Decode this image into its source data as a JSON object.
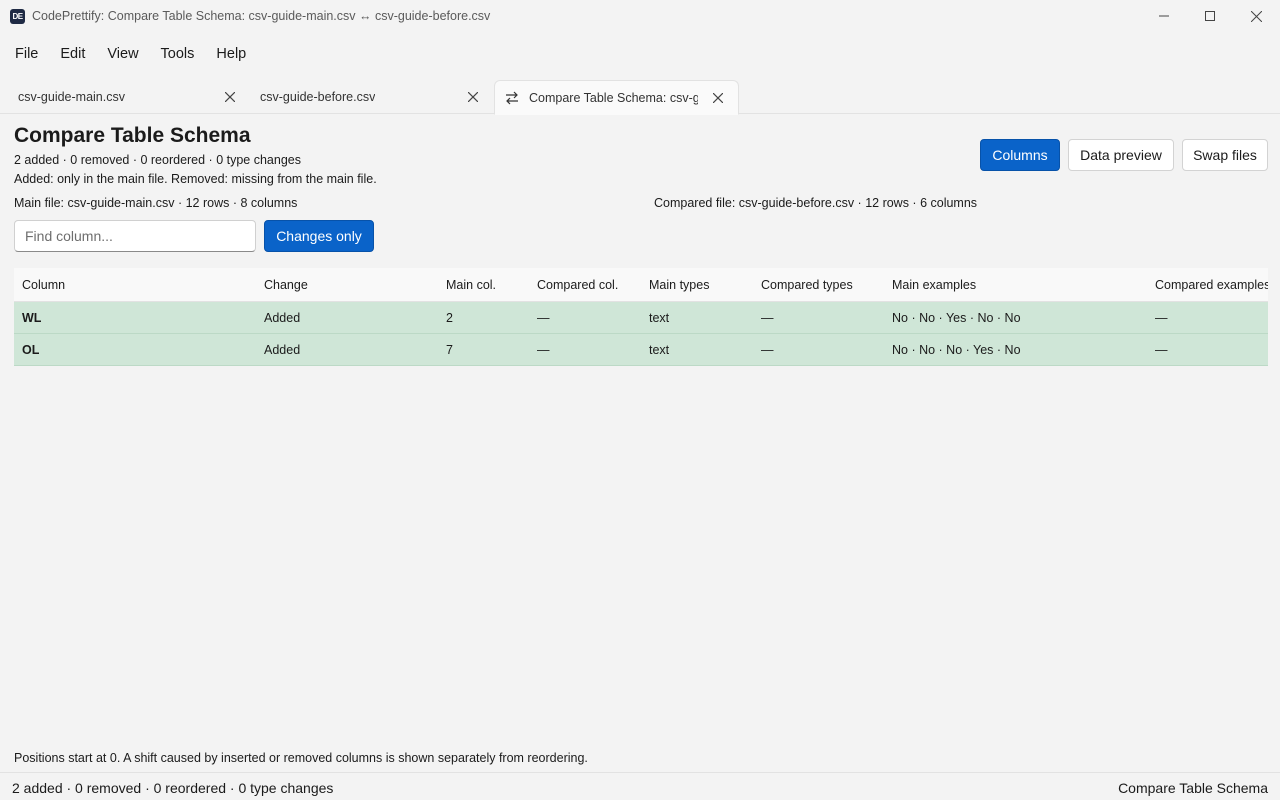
{
  "window": {
    "app_icon_text": "DE",
    "title": "CodePrettify: Compare Table Schema: csv-guide-main.csv ↔ csv-guide-before.csv"
  },
  "menu": [
    "File",
    "Edit",
    "View",
    "Tools",
    "Help"
  ],
  "tabs": [
    {
      "label": "csv-guide-main.csv",
      "active": false
    },
    {
      "label": "csv-guide-before.csv",
      "active": false
    },
    {
      "label": "Compare Table Schema: csv-guide-main.csv",
      "active": true
    }
  ],
  "page": {
    "title": "Compare Table Schema",
    "summary": "2 added · 0 removed · 0 reordered · 0 type changes",
    "legend": "Added: only in the main file. Removed: missing from the main file.",
    "main_file": "Main file: csv-guide-main.csv · 12 rows · 8 columns",
    "compared_file": "Compared file: csv-guide-before.csv · 12 rows · 6 columns"
  },
  "toolbar": {
    "columns_label": "Columns",
    "preview_label": "Data preview",
    "swap_label": "Swap files",
    "find_placeholder": "Find column...",
    "find_value": "",
    "changes_only_label": "Changes only"
  },
  "table": {
    "headers": [
      "Column",
      "Change",
      "Main col.",
      "Compared col.",
      "Main types",
      "Compared types",
      "Main examples",
      "Compared examples"
    ],
    "rows": [
      [
        "WL",
        "Added",
        "2",
        "—",
        "text",
        "—",
        "No · No · Yes · No · No",
        "—"
      ],
      [
        "OL",
        "Added",
        "7",
        "—",
        "text",
        "—",
        "No · No · No · Yes · No",
        "—"
      ]
    ]
  },
  "footnote": "Positions start at 0. A shift caused by inserted or removed columns is shown separately from reordering.",
  "status": {
    "left": "2 added · 0 removed · 0 reordered · 0 type changes",
    "right": "Compare Table Schema"
  },
  "colors": {
    "accent": "#0a63c9",
    "added_row": "#cfe6d7",
    "background": "#f3f3f3"
  }
}
